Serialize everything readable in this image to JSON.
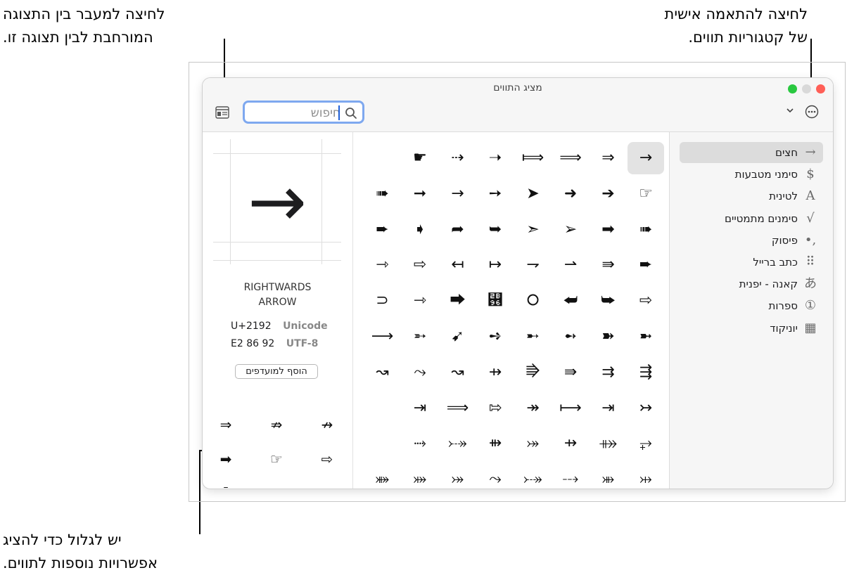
{
  "callouts": {
    "top_right": {
      "line1": "לחיצה להתאמה אישית",
      "line2": "של קטגוריות תווים."
    },
    "top_left": {
      "line1": "לחיצה למעבר בין התצוגה",
      "line2": "המורחבת לבין תצוגה זו."
    },
    "bottom_left": {
      "line1": "יש לגלול כדי להציג",
      "line2": "אפשרויות נוספות לתווים."
    }
  },
  "window": {
    "title": "מציג התווים"
  },
  "search": {
    "placeholder": "חיפוש",
    "value": ""
  },
  "icons": {
    "search": "search-icon",
    "view_toggle": "expanded-view-icon",
    "more": "ellipsis-circle-icon",
    "chevron": "chevron-down-icon"
  },
  "sidebar": {
    "items": [
      {
        "label": "חצים",
        "icon": "→",
        "icon_name": "arrow-icon",
        "selected": true
      },
      {
        "label": "סימני מטבעות",
        "icon": "$",
        "icon_name": "dollar-icon",
        "selected": false
      },
      {
        "label": "לטינית",
        "icon": "A",
        "icon_name": "latin-letter-icon",
        "selected": false
      },
      {
        "label": "סימנים מתמטיים",
        "icon": "√",
        "icon_name": "square-root-icon",
        "selected": false
      },
      {
        "label": "פיסוק",
        "icon": ",•",
        "icon_name": "punctuation-icon",
        "selected": false
      },
      {
        "label": "כתב ברייל",
        "icon": "⠿",
        "icon_name": "braille-icon",
        "selected": false
      },
      {
        "label": "קאנה - יפנית",
        "icon": "あ",
        "icon_name": "kana-icon",
        "selected": false
      },
      {
        "label": "ספרות",
        "icon": "①",
        "icon_name": "digits-icon",
        "selected": false
      },
      {
        "label": "יוניקוד",
        "icon": "▦",
        "icon_name": "unicode-grid-icon",
        "selected": false
      }
    ]
  },
  "grid": {
    "selected_index": 0,
    "rows": [
      [
        "→",
        "⇒",
        "⟹",
        "⟾",
        "➝",
        "⇢",
        "☛"
      ],
      [
        "☞",
        "➔",
        "➜",
        "➤",
        "➙",
        "→",
        "➞",
        "➠"
      ],
      [
        "➠",
        "➡",
        "➢",
        "➣",
        "➥",
        "➦",
        "➧",
        "➨"
      ],
      [
        "➨",
        "⇛",
        "⇀",
        "⇁",
        "↦",
        "↤",
        "⇨",
        "⇾"
      ],
      [
        "⇨",
        "⮩",
        "⮨",
        "⭘",
        "⮖",
        "⮕",
        "⇾",
        "⊃"
      ],
      [
        "➼",
        "➽",
        "➻",
        "➸",
        "➺",
        "➹",
        "➵",
        "⟶"
      ],
      [
        "⇶",
        "⇉",
        "⇛",
        "⭆",
        "⇸",
        "↝",
        "⤳",
        "↝"
      ],
      [
        "↣",
        "⇥",
        "⟼",
        "↠",
        "⇰",
        "⟹",
        "⇥"
      ],
      [
        "⥅",
        "⤁",
        "⇸",
        "⤖",
        "⇻",
        "⤐",
        "⤑"
      ],
      [
        "⤔",
        "⤕",
        "⤏",
        "⤐",
        "⤳",
        "⤖",
        "⤗",
        "⤘"
      ]
    ]
  },
  "detail": {
    "character": "→",
    "name_line1": "RIGHTWARDS",
    "name_line2": "ARROW",
    "codes": [
      {
        "value": "U+2192",
        "label": "Unicode"
      },
      {
        "value": "E2 86 92",
        "label": "UTF-8"
      }
    ],
    "add_favorite_label": "הוסף למועדפים",
    "related": [
      "⇒",
      "⇏",
      "↛",
      "➡",
      "☞",
      "⇨",
      "⍑",
      "⊕"
    ]
  }
}
